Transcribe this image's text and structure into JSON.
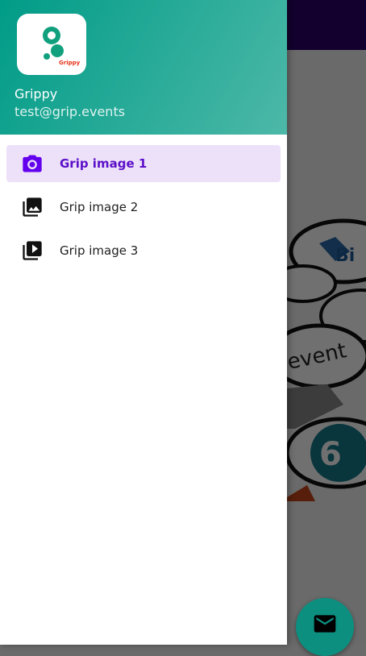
{
  "theme": {
    "primary": "#6200EE",
    "primary_dark": "#2C0069",
    "header_gradient_start": "#009C87",
    "header_gradient_end": "#4DB8A8",
    "active_bg": "#EDE1FA",
    "active_text": "#5B0FC8",
    "fab_color": "#0D8F80",
    "logo_green": "#10A07D",
    "logo_red": "#E8341C"
  },
  "drawer": {
    "header": {
      "logo_text": "Grippy",
      "name": "Grippy",
      "email": "test@grip.events"
    },
    "items": [
      {
        "label": "Grip image 1",
        "icon": "camera-icon",
        "active": true
      },
      {
        "label": "Grip image 2",
        "icon": "photo-library-icon",
        "active": false
      },
      {
        "label": "Grip image 3",
        "icon": "video-library-icon",
        "active": false
      }
    ]
  },
  "fab": {
    "icon": "mail-icon"
  }
}
